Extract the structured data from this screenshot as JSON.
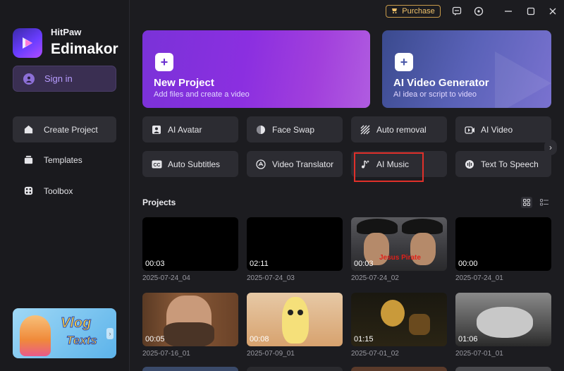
{
  "app": {
    "brand_top": "HitPaw",
    "brand_main": "Edimakor"
  },
  "titlebar": {
    "purchase_label": "Purchase"
  },
  "sidebar": {
    "signin_label": "Sign in",
    "items": [
      {
        "label": "Create Project",
        "icon": "home-icon",
        "active": true
      },
      {
        "label": "Templates",
        "icon": "templates-icon",
        "active": false
      },
      {
        "label": "Toolbox",
        "icon": "toolbox-icon",
        "active": false
      }
    ],
    "banner": {
      "line1": "Vlog",
      "line2": "Texts"
    }
  },
  "hero": [
    {
      "title": "New Project",
      "subtitle": "Add files and create a video"
    },
    {
      "title": "AI Video Generator",
      "subtitle": "AI idea or script to video"
    }
  ],
  "tools": [
    {
      "label": "AI Avatar",
      "icon": "avatar-icon"
    },
    {
      "label": "Face Swap",
      "icon": "face-swap-icon"
    },
    {
      "label": "Auto removal",
      "icon": "auto-removal-icon"
    },
    {
      "label": "AI Video",
      "icon": "ai-video-icon"
    },
    {
      "label": "Auto Subtitles",
      "icon": "cc-icon"
    },
    {
      "label": "Video Translator",
      "icon": "translate-icon"
    },
    {
      "label": "AI Music",
      "icon": "music-icon"
    },
    {
      "label": "Text To Speech",
      "icon": "speech-icon"
    }
  ],
  "projects": {
    "heading": "Projects",
    "items": [
      {
        "duration": "00:03",
        "name": "2025-07-24_04"
      },
      {
        "duration": "02:11",
        "name": "2025-07-24_03"
      },
      {
        "duration": "00:03",
        "name": "2025-07-24_02",
        "overlay_text": "Jesus Pirate"
      },
      {
        "duration": "00:00",
        "name": "2025-07-24_01"
      },
      {
        "duration": "00:05",
        "name": "2025-07-16_01"
      },
      {
        "duration": "00:08",
        "name": "2025-07-09_01"
      },
      {
        "duration": "01:15",
        "name": "2025-07-01_02"
      },
      {
        "duration": "01:06",
        "name": "2025-07-01_01"
      }
    ]
  },
  "colors": {
    "accent": "#8b2fe0",
    "highlight": "#e0302a",
    "purchase": "#f0c26a"
  }
}
